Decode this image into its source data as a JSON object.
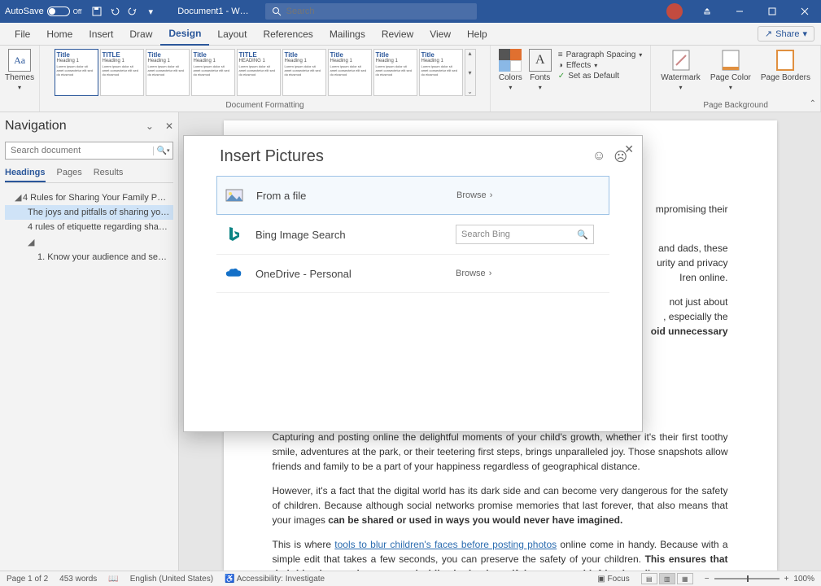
{
  "titlebar": {
    "autosave_label": "AutoSave",
    "autosave_state": "Off",
    "doc_title": "Document1 - W…",
    "search_placeholder": "Search"
  },
  "menu": {
    "tabs": [
      "File",
      "Home",
      "Insert",
      "Draw",
      "Design",
      "Layout",
      "References",
      "Mailings",
      "Review",
      "View",
      "Help"
    ],
    "active": "Design",
    "share_label": "Share"
  },
  "ribbon": {
    "themes_label": "Themes",
    "gallery_items": [
      {
        "t": "Title",
        "s": "Heading 1"
      },
      {
        "t": "TITLE",
        "s": "Heading 1"
      },
      {
        "t": "Title",
        "s": "Heading 1"
      },
      {
        "t": "Title",
        "s": "Heading 1"
      },
      {
        "t": "TITLE",
        "s": "HEADING 1"
      },
      {
        "t": "Title",
        "s": "Heading 1"
      },
      {
        "t": "Title",
        "s": "Heading 1"
      },
      {
        "t": "Title",
        "s": "Heading 1"
      },
      {
        "t": "Title",
        "s": "Heading 1"
      }
    ],
    "group_formatting": "Document Formatting",
    "colors_label": "Colors",
    "fonts_label": "Fonts",
    "paragraph_spacing": "Paragraph Spacing",
    "effects": "Effects",
    "set_default": "Set as Default",
    "watermark": "Watermark",
    "page_color": "Page Color",
    "page_borders": "Page Borders",
    "group_page_bg": "Page Background"
  },
  "nav": {
    "title": "Navigation",
    "search_placeholder": "Search document",
    "tabs": [
      "Headings",
      "Pages",
      "Results"
    ],
    "active_tab": "Headings",
    "tree": {
      "h1": "4 Rules for Sharing Your Family Phot…",
      "h2a": "The joys and pitfalls of sharing yo…",
      "h2b": "4 rules of etiquette regarding sha…",
      "h3a": "1. Know your audience and se…"
    }
  },
  "dialog": {
    "title": "Insert Pictures",
    "sources": {
      "file": {
        "label": "From a file",
        "action": "Browse"
      },
      "bing": {
        "label": "Bing Image Search",
        "placeholder": "Search Bing"
      },
      "onedrive": {
        "label": "OneDrive - Personal",
        "action": "Browse"
      }
    }
  },
  "doc": {
    "frag1a": "mpromising their",
    "frag2a": "and dads, these",
    "frag2b": "urity and privacy",
    "frag2c": "Iren online.",
    "frag3a": "not just about",
    "frag3b": ", especially the",
    "frag3c": "oid unnecessary",
    "p4": "Capturing and posting online the delightful moments of your child's growth, whether it's their first toothy smile, adventures at the park, or their teetering first steps, brings unparalleled joy. Those snapshots allow friends and family to be a part of your happiness regardless of geographical distance.",
    "p5a": "However, it's a fact that the digital world has its dark side and can become very dangerous for the safety of children. Because although social networks promise memories that last forever, that also means that your images ",
    "p5b": "can be shared or used in ways you would never have imagined.",
    "p6a": "This is where ",
    "p6link": "tools to blur children's faces before posting photos",
    "p6b": " online come in handy. Because with a simple edit that takes a few seconds, you can preserve the safety of your children. ",
    "p6c": "This ensures that their identity remains protected while sharing beautiful moments with friends online."
  },
  "status": {
    "page": "Page 1 of 2",
    "words": "453 words",
    "lang": "English (United States)",
    "accessibility": "Accessibility: Investigate",
    "focus": "Focus",
    "zoom": "100%"
  }
}
